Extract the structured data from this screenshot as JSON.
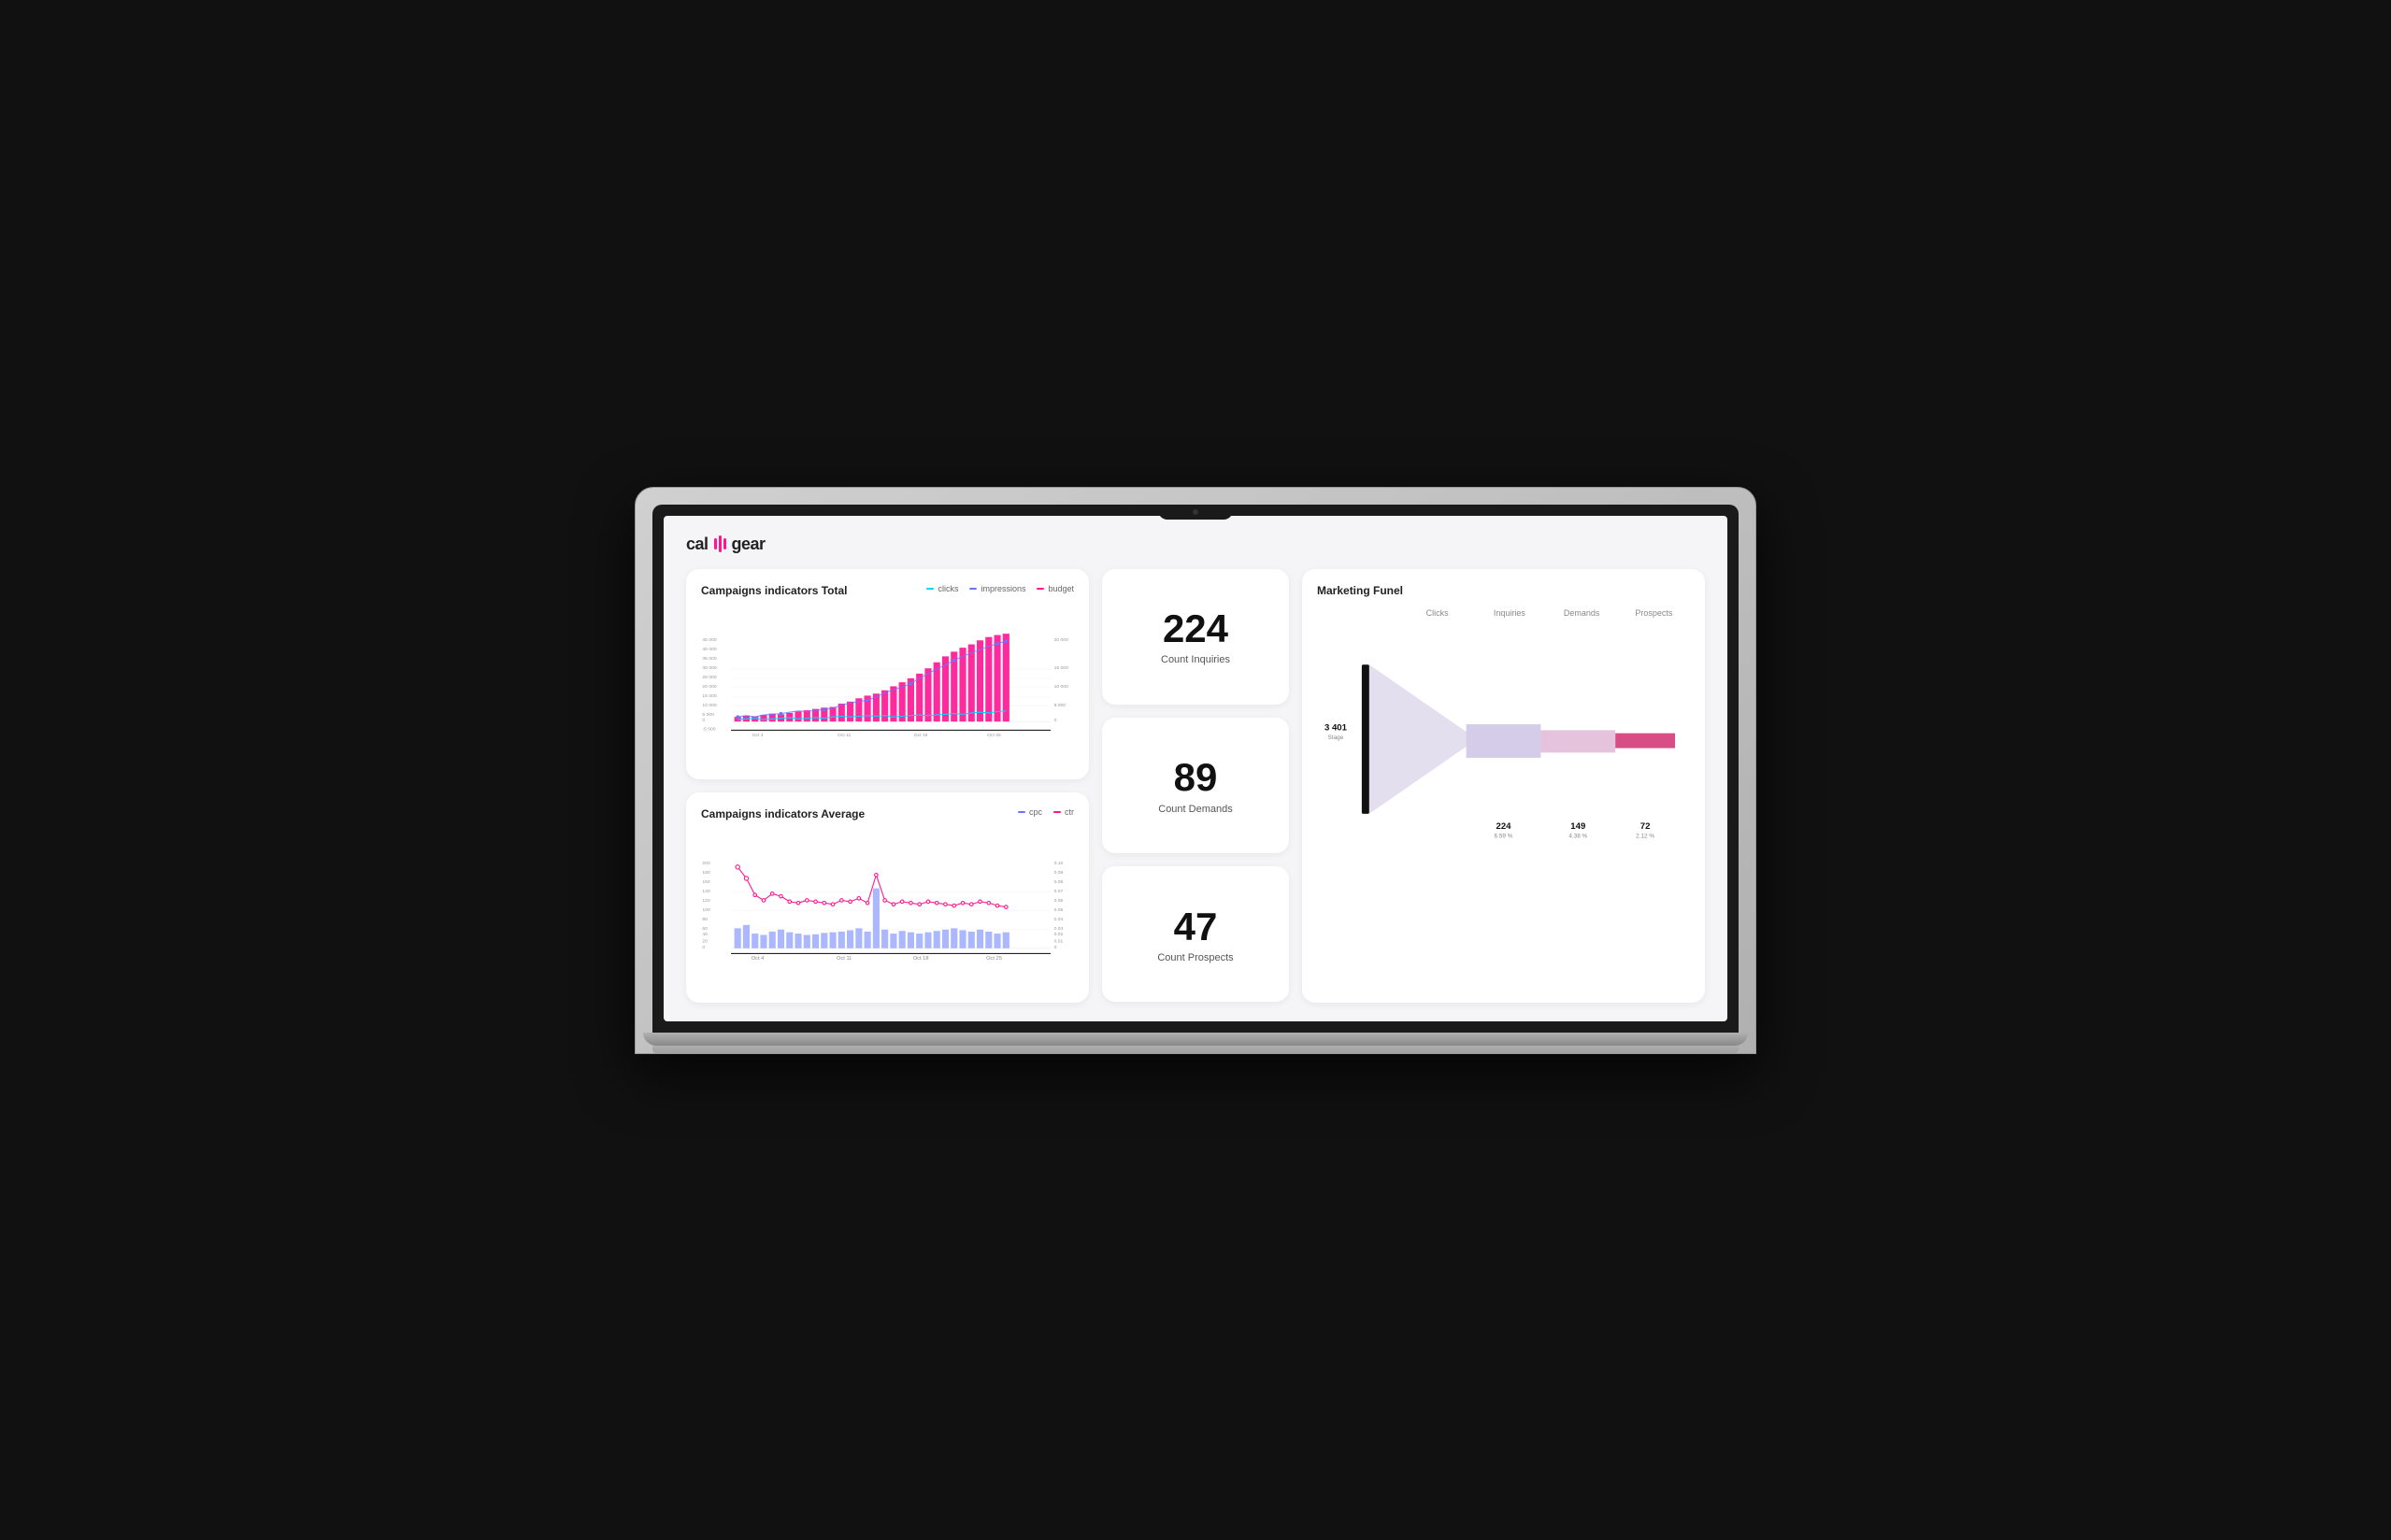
{
  "logo": {
    "text_left": "cal",
    "text_right": "gear"
  },
  "charts": {
    "total": {
      "title": "Campaigns indicators Total",
      "legend": [
        {
          "label": "clicks",
          "color": "#00d4ff"
        },
        {
          "label": "impressions",
          "color": "#6677ff"
        },
        {
          "label": "budget",
          "color": "#ff1493"
        }
      ],
      "yAxis": [
        "45 000",
        "40 000",
        "35 000",
        "30 000",
        "25 000",
        "20 000",
        "15 000",
        "10 000",
        "5 000",
        "0",
        "-5 000"
      ],
      "yAxis2": [
        "20 000",
        "15 000",
        "10 000",
        "5 000",
        "0"
      ],
      "xAxis": [
        "Oct 4",
        "Oct 11",
        "Oct 18",
        "Oct 25"
      ]
    },
    "average": {
      "title": "Campaigns indicators Average",
      "legend": [
        {
          "label": "cpc",
          "color": "#6677ff"
        },
        {
          "label": "ctr",
          "color": "#ff1493"
        }
      ],
      "yAxis": [
        "200",
        "180",
        "160",
        "140",
        "120",
        "100",
        "80",
        "60",
        "40",
        "20",
        "0"
      ],
      "yAxis2": [
        "0.10",
        "0.09",
        "0.08",
        "0.07",
        "0.06",
        "0.05",
        "0.04",
        "0.03",
        "0.02",
        "0.01",
        "0"
      ],
      "xAxis": [
        "Oct 4",
        "Oct 11",
        "Oct 18",
        "Oct 25"
      ]
    }
  },
  "stats": [
    {
      "number": "224",
      "label": "Count Inquiries"
    },
    {
      "number": "89",
      "label": "Count Demands"
    },
    {
      "number": "47",
      "label": "Count Prospects"
    }
  ],
  "funnel": {
    "title": "Marketing Funel",
    "labels": [
      "Clicks",
      "Inquiries",
      "Demands",
      "Prospects"
    ],
    "stage_label": "Stage",
    "stage_value": "3 401",
    "values": [
      {
        "num": "224",
        "pct": "6.59 %"
      },
      {
        "num": "149",
        "pct": "4.38 %"
      },
      {
        "num": "72",
        "pct": "2.12 %"
      }
    ]
  }
}
